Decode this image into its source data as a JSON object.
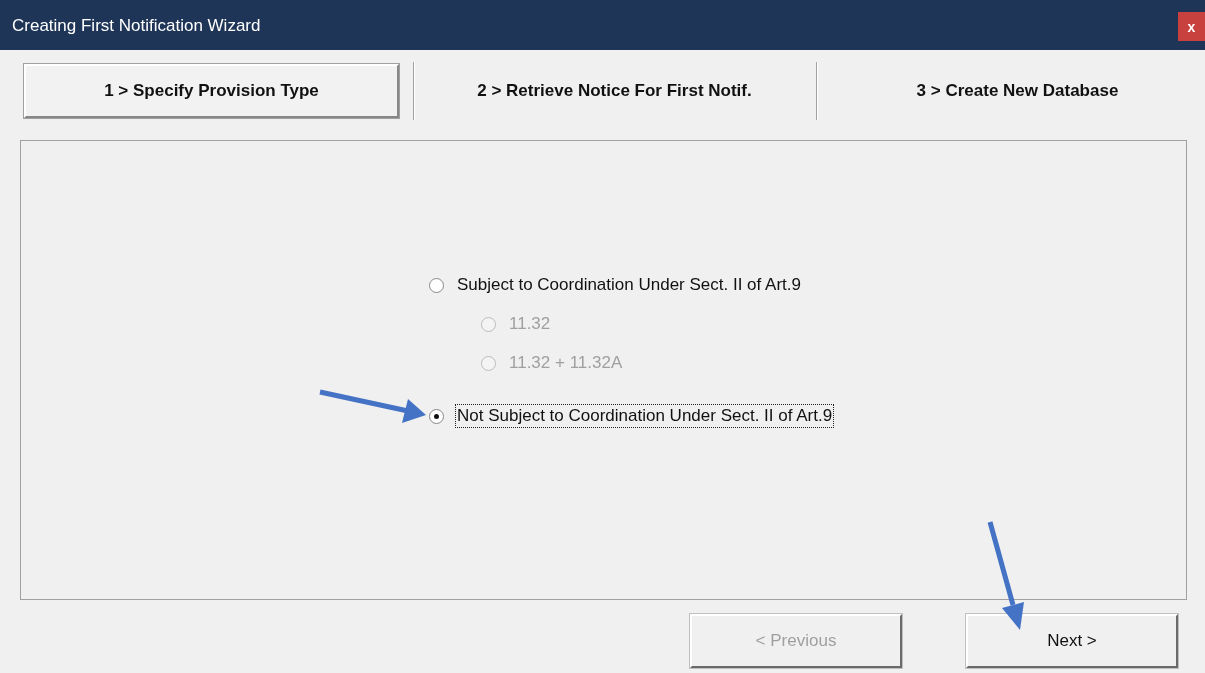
{
  "window": {
    "title": "Creating First Notification Wizard",
    "close_label": "x"
  },
  "steps": [
    {
      "label": "1 > Specify Provision Type",
      "selected": true
    },
    {
      "label": "2 > Retrieve Notice For First Notif.",
      "selected": false
    },
    {
      "label": "3 > Create New Database",
      "selected": false
    }
  ],
  "options": [
    {
      "label": "Subject to Coordination Under Sect. II of Art.9",
      "selected": false,
      "disabled": false,
      "focused": false,
      "children": [
        {
          "label": "11.32",
          "selected": false,
          "disabled": true,
          "focused": false
        },
        {
          "label": "11.32 + 11.32A",
          "selected": false,
          "disabled": true,
          "focused": false
        }
      ]
    },
    {
      "label": "Not Subject to Coordination Under Sect. II of Art.9",
      "selected": true,
      "disabled": false,
      "focused": true
    }
  ],
  "buttons": [
    {
      "label": "< Previous",
      "disabled": true
    },
    {
      "label": "Next >",
      "disabled": false
    }
  ]
}
